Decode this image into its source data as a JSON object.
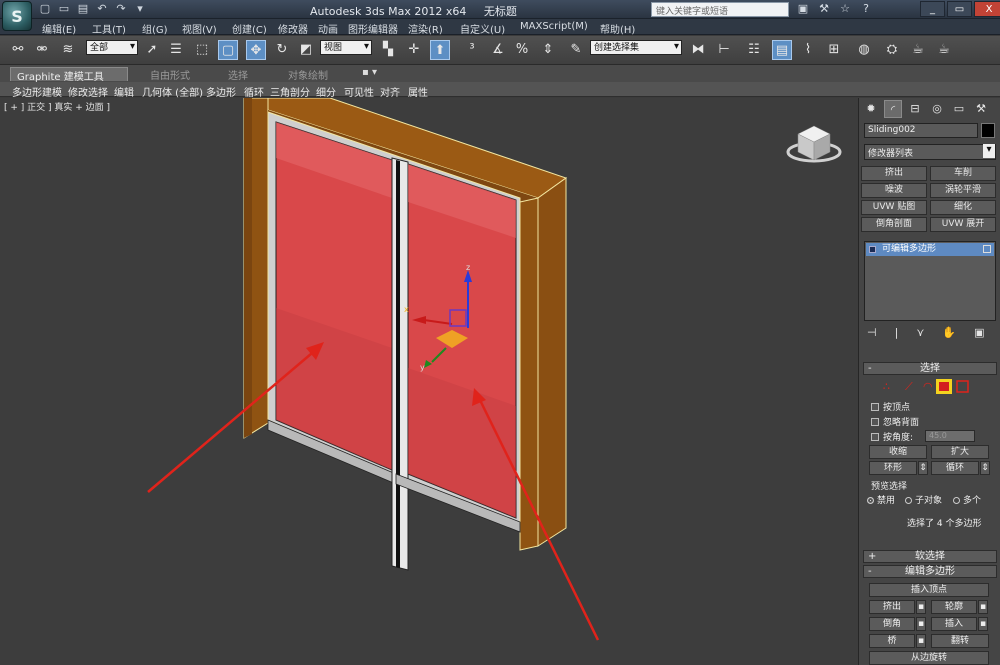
{
  "app": {
    "logo": "S",
    "title_parts": [
      "Autodesk 3ds Max  2012 x64",
      "无标题"
    ],
    "search_placeholder": "键入关键字或短语"
  },
  "quick_access": [
    "new-icon",
    "open-icon",
    "save-icon",
    "undo-icon",
    "redo-icon",
    "dropdown-icon"
  ],
  "quick_access_glyphs": [
    "▢",
    "▭",
    "▤",
    "↶",
    "↷",
    "▾"
  ],
  "title_tools": [
    "▣",
    "⚒",
    "☆",
    "?"
  ],
  "window_buttons": [
    "_",
    "▭",
    "X"
  ],
  "menu": [
    "编辑(E)",
    "工具(T)",
    "组(G)",
    "视图(V)",
    "创建(C)",
    "修改器",
    "动画",
    "图形编辑器",
    "渲染(R)",
    "自定义(U)",
    "MAXScript(M)",
    "帮助(H)"
  ],
  "toolbar": {
    "selection_filter": "全部",
    "ref_coord": "视图",
    "named_selection": "创建选择集",
    "icons": [
      "link",
      "unlink",
      "bind",
      "select",
      "select-by-name",
      "rect-region",
      "window-crossing",
      "move",
      "rotate",
      "scale",
      "pivot",
      "snap",
      "angle-snap",
      "percent-snap",
      "spinner-snap",
      "edit-named-sel",
      "mirror",
      "align",
      "layers",
      "ribbon-toggle",
      "curve-editor",
      "schematic",
      "material-editor",
      "render-setup",
      "rendered-frame",
      "render"
    ]
  },
  "ribbon": {
    "tabs": [
      "Graphite 建模工具",
      "自由形式",
      "选择",
      "对象绘制"
    ],
    "tabs_extra": "▪ ▾",
    "panels": [
      "多边形建模",
      "修改选择",
      "编辑",
      "几何体 (全部)",
      "多边形",
      "循环",
      "三角剖分",
      "细分",
      "可见性",
      "对齐",
      "属性"
    ]
  },
  "viewport": {
    "label": "[ + ] 正交 ] 真实 + 边面 ]",
    "gizmo_axes": [
      "z",
      "x",
      "y"
    ]
  },
  "command_panel": {
    "tab_icons": [
      "create-icon",
      "modify-icon",
      "hierarchy-icon",
      "motion-icon",
      "display-icon",
      "utilities-icon"
    ],
    "tab_glyphs": [
      "✹",
      "◜",
      "⊟",
      "◎",
      "▭",
      "⚒"
    ],
    "object_name": "Sliding002",
    "modifier_list": "修改器列表",
    "modifier_buttons": [
      "挤出",
      "车削",
      "噪波",
      "涡轮平滑",
      "UVW 贴图",
      "细化",
      "倒角剖面",
      "UVW 展开"
    ],
    "stack_item": "可编辑多边形",
    "stack_tools": [
      "⊣",
      "|",
      "⋎",
      "✋",
      "▣"
    ],
    "selection": {
      "title": "选择",
      "by_vertex": "按顶点",
      "ignore_backfacing": "忽略背面",
      "by_angle": "按角度:",
      "angle_value": "45.0",
      "shrink": "收缩",
      "grow": "扩大",
      "ring": "环形",
      "loop": "循环",
      "preview_label": "预览选择",
      "preview_options": [
        "禁用",
        "子对象",
        "多个"
      ],
      "status": "选择了 4 个多边形"
    },
    "soft_selection": "软选择",
    "edit_polygons": {
      "title": "编辑多边形",
      "insert_vertex": "插入顶点",
      "buttons": [
        "挤出",
        "轮廓",
        "倒角",
        "插入",
        "桥",
        "翻转"
      ],
      "from_edge": "从边旋转"
    },
    "rollout_signs": [
      "-",
      "+",
      "-"
    ]
  },
  "colors": {
    "selected_face": "#d9484a",
    "frame_wood": "#9b5a14",
    "accent_blue": "#5e8ac2",
    "arrow": "#e0231b"
  }
}
